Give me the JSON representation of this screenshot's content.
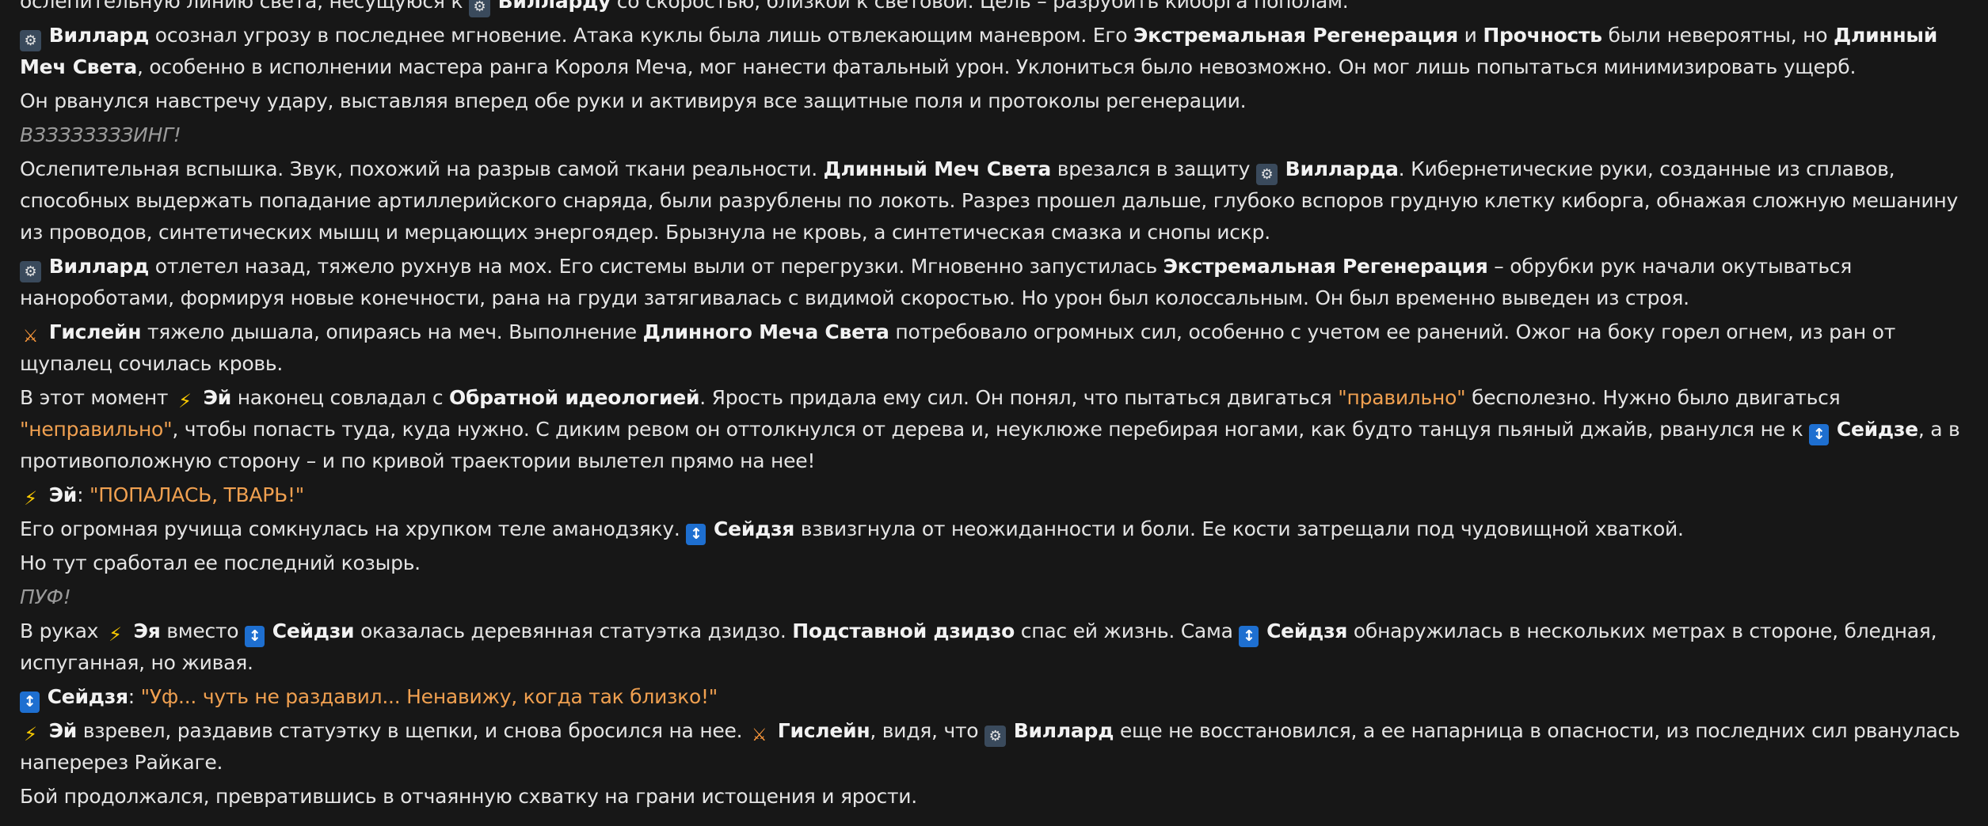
{
  "icons": {
    "cyborg-icon": {
      "glyph": "⚙",
      "class": "cyborg"
    },
    "blade-icon": {
      "glyph": "⚔",
      "class": "blade"
    },
    "lightning-icon": {
      "glyph": "⚡",
      "class": "lightning"
    },
    "shinobi-icon": {
      "glyph": "↕",
      "class": "shinobi"
    }
  },
  "colors": {
    "background": "#171717",
    "text": "#e4e4e4",
    "quote": "#f0a050",
    "sound": "#9a9a9a",
    "shinobi_badge": "#1e6fd0"
  },
  "paragraphs": [
    {
      "name": "para-cut-top",
      "segments": [
        {
          "t": "n",
          "v": "ослепительную линию света, несущуюся к "
        },
        {
          "t": "e",
          "v": "cyborg-icon"
        },
        {
          "t": "b",
          "v": "Вилларду"
        },
        {
          "t": "n",
          "v": " со скоростью, близкой к световой. Цель – разрубить киборга пополам."
        }
      ]
    },
    {
      "name": "para-01",
      "segments": [
        {
          "t": "e",
          "v": "cyborg-icon"
        },
        {
          "t": "b",
          "v": "Виллард"
        },
        {
          "t": "n",
          "v": " осознал угрозу в последнее мгновение. Атака куклы была лишь отвлекающим маневром. Его "
        },
        {
          "t": "b",
          "v": "Экстремальная Регенерация"
        },
        {
          "t": "n",
          "v": " и "
        },
        {
          "t": "b",
          "v": "Прочность"
        },
        {
          "t": "n",
          "v": " были невероятны, но "
        },
        {
          "t": "b",
          "v": "Длинный Меч Света"
        },
        {
          "t": "n",
          "v": ", особенно в исполнении мастера ранга Короля Меча, мог нанести фатальный урон. Уклониться было невозможно. Он мог лишь попытаться минимизировать ущерб."
        }
      ]
    },
    {
      "name": "para-02",
      "segments": [
        {
          "t": "n",
          "v": "Он рванулся навстречу удару, выставляя вперед обе руки и активируя все защитные поля и протоколы регенерации."
        }
      ]
    },
    {
      "name": "para-03-sound",
      "segments": [
        {
          "t": "i",
          "v": "ВЗЗЗЗЗЗЗЗИНГ!"
        }
      ]
    },
    {
      "name": "para-04",
      "segments": [
        {
          "t": "n",
          "v": "Ослепительная вспышка. Звук, похожий на разрыв самой ткани реальности. "
        },
        {
          "t": "b",
          "v": "Длинный Меч Света"
        },
        {
          "t": "n",
          "v": " врезался в защиту "
        },
        {
          "t": "e",
          "v": "cyborg-icon"
        },
        {
          "t": "b",
          "v": "Вилларда"
        },
        {
          "t": "n",
          "v": ". Кибернетические руки, созданные из сплавов, способных выдержать попадание артиллерийского снаряда, были разрублены по локоть. Разрез прошел дальше, глубоко вспоров грудную клетку киборга, обнажая сложную мешанину из проводов, синтетических мышц и мерцающих энергоядер. Брызнула не кровь, а синтетическая смазка и снопы искр."
        }
      ]
    },
    {
      "name": "para-05",
      "segments": [
        {
          "t": "e",
          "v": "cyborg-icon"
        },
        {
          "t": "b",
          "v": "Виллард"
        },
        {
          "t": "n",
          "v": " отлетел назад, тяжело рухнув на мох. Его системы выли от перегрузки. Мгновенно запустилась "
        },
        {
          "t": "b",
          "v": "Экстремальная Регенерация"
        },
        {
          "t": "n",
          "v": " – обрубки рук начали окутываться нанороботами, формируя новые конечности, рана на груди затягивалась с видимой скоростью. Но урон был колоссальным. Он был временно выведен из строя."
        }
      ]
    },
    {
      "name": "para-06",
      "segments": [
        {
          "t": "e",
          "v": "blade-icon"
        },
        {
          "t": "b",
          "v": "Гислейн"
        },
        {
          "t": "n",
          "v": " тяжело дышала, опираясь на меч. Выполнение "
        },
        {
          "t": "b",
          "v": "Длинного Меча Света"
        },
        {
          "t": "n",
          "v": " потребовало огромных сил, особенно с учетом ее ранений. Ожог на боку горел огнем, из ран от щупалец сочилась кровь."
        }
      ]
    },
    {
      "name": "para-07",
      "segments": [
        {
          "t": "n",
          "v": "В этот момент "
        },
        {
          "t": "e",
          "v": "lightning-icon"
        },
        {
          "t": "b",
          "v": "Эй"
        },
        {
          "t": "n",
          "v": " наконец совладал с "
        },
        {
          "t": "b",
          "v": "Обратной идеологией"
        },
        {
          "t": "n",
          "v": ". Ярость придала ему сил. Он понял, что пытаться двигаться "
        },
        {
          "t": "q",
          "v": "\"правильно\""
        },
        {
          "t": "n",
          "v": " бесполезно. Нужно было двигаться "
        },
        {
          "t": "q",
          "v": "\"неправильно\""
        },
        {
          "t": "n",
          "v": ", чтобы попасть туда, куда нужно. С диким ревом он оттолкнулся от дерева и, неуклюже перебирая ногами, как будто танцуя пьяный джайв, рванулся не к "
        },
        {
          "t": "e",
          "v": "shinobi-icon"
        },
        {
          "t": "b",
          "v": "Сейдзе"
        },
        {
          "t": "n",
          "v": ", а в противоположную сторону – и по кривой траектории вылетел прямо на нее!"
        }
      ]
    },
    {
      "name": "para-08-dialogue",
      "segments": [
        {
          "t": "e",
          "v": "lightning-icon"
        },
        {
          "t": "b",
          "v": "Эй"
        },
        {
          "t": "n",
          "v": ": "
        },
        {
          "t": "q",
          "v": "\"ПОПАЛАСЬ, ТВАРЬ!\""
        }
      ]
    },
    {
      "name": "para-09",
      "segments": [
        {
          "t": "n",
          "v": "Его огромная ручища сомкнулась на хрупком теле аманодзяку. "
        },
        {
          "t": "e",
          "v": "shinobi-icon"
        },
        {
          "t": "b",
          "v": "Сейдзя"
        },
        {
          "t": "n",
          "v": " взвизгнула от неожиданности и боли. Ее кости затрещали под чудовищной хваткой."
        }
      ]
    },
    {
      "name": "para-10",
      "segments": [
        {
          "t": "n",
          "v": "Но тут сработал ее последний козырь."
        }
      ]
    },
    {
      "name": "para-11-sound",
      "segments": [
        {
          "t": "i",
          "v": "ПУФ!"
        }
      ]
    },
    {
      "name": "para-12",
      "segments": [
        {
          "t": "n",
          "v": "В руках "
        },
        {
          "t": "e",
          "v": "lightning-icon"
        },
        {
          "t": "b",
          "v": "Эя"
        },
        {
          "t": "n",
          "v": " вместо "
        },
        {
          "t": "e",
          "v": "shinobi-icon"
        },
        {
          "t": "b",
          "v": "Сейдзи"
        },
        {
          "t": "n",
          "v": " оказалась деревянная статуэтка дзидзо. "
        },
        {
          "t": "b",
          "v": "Подставной дзидзо"
        },
        {
          "t": "n",
          "v": " спас ей жизнь. Сама "
        },
        {
          "t": "e",
          "v": "shinobi-icon"
        },
        {
          "t": "b",
          "v": "Сейдзя"
        },
        {
          "t": "n",
          "v": " обнаружилась в нескольких метрах в стороне, бледная, испуганная, но живая."
        }
      ]
    },
    {
      "name": "para-13-dialogue",
      "segments": [
        {
          "t": "e",
          "v": "shinobi-icon"
        },
        {
          "t": "b",
          "v": "Сейдзя"
        },
        {
          "t": "n",
          "v": ": "
        },
        {
          "t": "q",
          "v": "\"Уф... чуть не раздавил... Ненавижу, когда так близко!\""
        }
      ]
    },
    {
      "name": "para-14",
      "segments": [
        {
          "t": "e",
          "v": "lightning-icon"
        },
        {
          "t": "b",
          "v": "Эй"
        },
        {
          "t": "n",
          "v": " взревел, раздавив статуэтку в щепки, и снова бросился на нее. "
        },
        {
          "t": "e",
          "v": "blade-icon"
        },
        {
          "t": "b",
          "v": "Гислейн"
        },
        {
          "t": "n",
          "v": ", видя, что "
        },
        {
          "t": "e",
          "v": "cyborg-icon"
        },
        {
          "t": "b",
          "v": "Виллард"
        },
        {
          "t": "n",
          "v": " еще не восстановился, а ее напарница в опасности, из последних сил рванулась наперерез Райкаге."
        }
      ]
    },
    {
      "name": "para-15",
      "segments": [
        {
          "t": "n",
          "v": "Бой продолжался, превратившись в отчаянную схватку на грани истощения и ярости."
        }
      ]
    }
  ]
}
